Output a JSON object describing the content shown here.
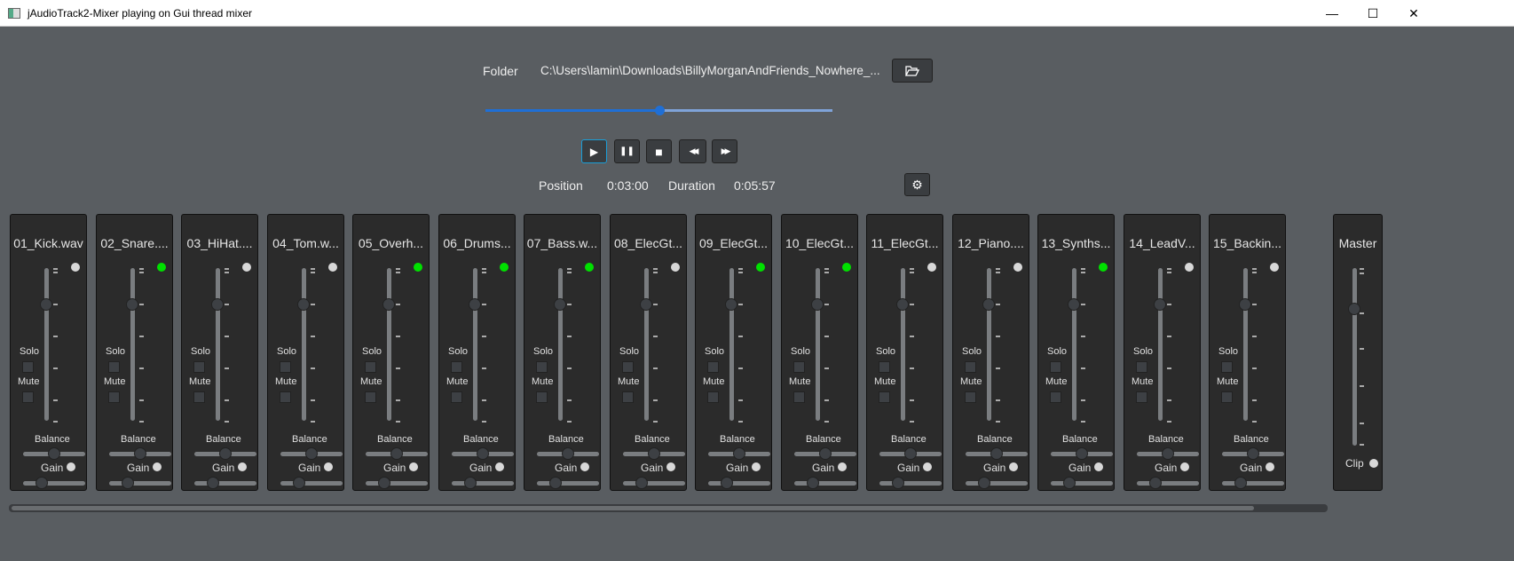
{
  "window": {
    "title": "jAudioTrack2-Mixer playing on Gui thread mixer",
    "minimize": "—",
    "maximize": "☐",
    "close": "✕"
  },
  "folder": {
    "label": "Folder",
    "path": "C:\\Users\\lamin\\Downloads\\BillyMorganAndFriends_Nowhere_...",
    "open_icon": "folder-open-icon"
  },
  "progress": {
    "fraction": 0.5
  },
  "transport": {
    "play": "▶",
    "pause": "❚❚",
    "stop": "■",
    "rewind": "◀◀",
    "forward": "▶▶"
  },
  "position": {
    "label": "Position",
    "value": "0:03:00"
  },
  "duration": {
    "label": "Duration",
    "value": "0:05:57"
  },
  "settings_icon": "⚙",
  "labels": {
    "solo": "Solo",
    "mute": "Mute",
    "balance": "Balance",
    "gain": "Gain",
    "clip": "Clip"
  },
  "tracks": [
    {
      "name": "01_Kick.wav",
      "active": false
    },
    {
      "name": "02_Snare....",
      "active": true
    },
    {
      "name": "03_HiHat....",
      "active": false
    },
    {
      "name": "04_Tom.w...",
      "active": false
    },
    {
      "name": "05_Overh...",
      "active": true
    },
    {
      "name": "06_Drums...",
      "active": true
    },
    {
      "name": "07_Bass.w...",
      "active": true
    },
    {
      "name": "08_ElecGt...",
      "active": false
    },
    {
      "name": "09_ElecGt...",
      "active": true
    },
    {
      "name": "10_ElecGt...",
      "active": true
    },
    {
      "name": "11_ElecGt...",
      "active": false
    },
    {
      "name": "12_Piano....",
      "active": false
    },
    {
      "name": "13_Synths...",
      "active": true
    },
    {
      "name": "14_LeadV...",
      "active": false
    },
    {
      "name": "15_Backin...",
      "active": false
    }
  ],
  "master": {
    "name": "Master",
    "volume_fraction": 0.77
  },
  "track_volume_fraction": 0.76,
  "balance_fraction": 0.5,
  "gain_fraction": 0.25,
  "colors": {
    "led_on": "#00e000",
    "led_off": "#d8d8d8",
    "progress": "#1f6fd6"
  }
}
